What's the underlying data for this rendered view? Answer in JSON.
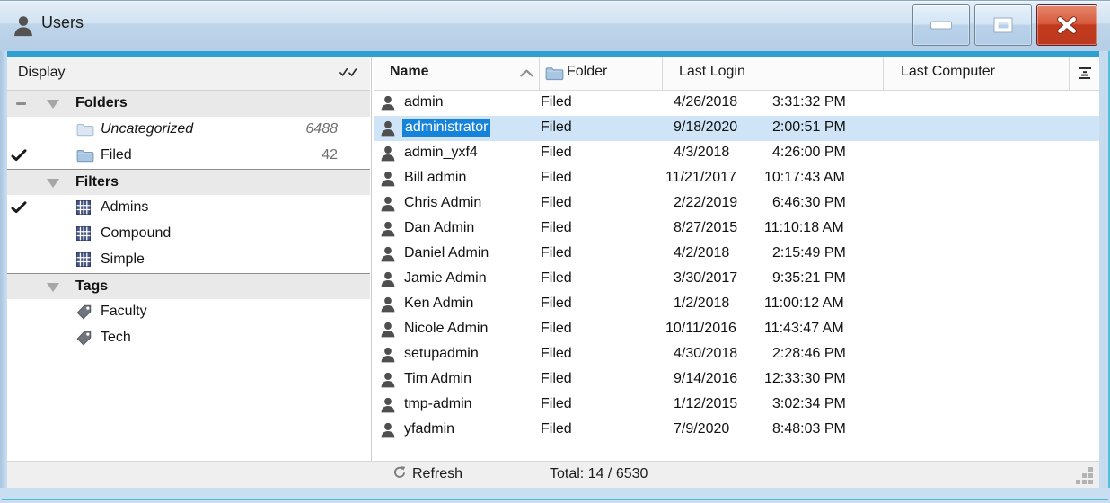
{
  "window": {
    "title": "Users",
    "controls": {
      "minimize": "minimize",
      "maximize": "maximize",
      "close": "close"
    }
  },
  "left_panel": {
    "header_label": "Display",
    "sections": [
      {
        "label": "Folders",
        "has_minus": true,
        "items": [
          {
            "label": "Uncategorized",
            "icon": "folder-empty",
            "count": "6488",
            "italic": true,
            "checked": false
          },
          {
            "label": "Filed",
            "icon": "folder",
            "count": "42",
            "italic": false,
            "checked": true
          }
        ]
      },
      {
        "label": "Filters",
        "has_minus": false,
        "items": [
          {
            "label": "Admins",
            "icon": "filter-grid",
            "checked": true
          },
          {
            "label": "Compound",
            "icon": "filter-grid",
            "checked": false
          },
          {
            "label": "Simple",
            "icon": "filter-grid",
            "checked": false
          }
        ]
      },
      {
        "label": "Tags",
        "has_minus": false,
        "items": [
          {
            "label": "Faculty",
            "icon": "tag",
            "checked": false
          },
          {
            "label": "Tech",
            "icon": "tag",
            "checked": false
          }
        ]
      }
    ]
  },
  "table": {
    "columns": {
      "name": "Name",
      "folder": "Folder",
      "last_login": "Last Login",
      "last_computer": "Last Computer"
    },
    "sort": {
      "column": "Name",
      "direction": "ascending"
    },
    "rows": [
      {
        "name": "admin",
        "folder": "Filed",
        "login_date": "4/26/2018",
        "login_time": "3:31:32 PM",
        "last_computer": "",
        "selected": false
      },
      {
        "name": "administrator",
        "folder": "Filed",
        "login_date": "9/18/2020",
        "login_time": "2:00:51 PM",
        "last_computer": "",
        "selected": true
      },
      {
        "name": "admin_yxf4",
        "folder": "Filed",
        "login_date": "4/3/2018",
        "login_time": "4:26:00 PM",
        "last_computer": "",
        "selected": false
      },
      {
        "name": "Bill admin",
        "folder": "Filed",
        "login_date": "11/21/2017",
        "login_time": "10:17:43 AM",
        "last_computer": "",
        "selected": false
      },
      {
        "name": "Chris Admin",
        "folder": "Filed",
        "login_date": "2/22/2019",
        "login_time": "6:46:30 PM",
        "last_computer": "",
        "selected": false
      },
      {
        "name": "Dan Admin",
        "folder": "Filed",
        "login_date": "8/27/2015",
        "login_time": "11:10:18 AM",
        "last_computer": "",
        "selected": false
      },
      {
        "name": "Daniel Admin",
        "folder": "Filed",
        "login_date": "4/2/2018",
        "login_time": "2:15:49 PM",
        "last_computer": "",
        "selected": false
      },
      {
        "name": "Jamie Admin",
        "folder": "Filed",
        "login_date": "3/30/2017",
        "login_time": "9:35:21 PM",
        "last_computer": "",
        "selected": false
      },
      {
        "name": "Ken Admin",
        "folder": "Filed",
        "login_date": "1/2/2018",
        "login_time": "11:00:12 AM",
        "last_computer": "",
        "selected": false
      },
      {
        "name": "Nicole Admin",
        "folder": "Filed",
        "login_date": "10/11/2016",
        "login_time": "11:43:47 AM",
        "last_computer": "",
        "selected": false
      },
      {
        "name": "setupadmin",
        "folder": "Filed",
        "login_date": "4/30/2018",
        "login_time": "2:28:46 PM",
        "last_computer": "",
        "selected": false
      },
      {
        "name": "Tim Admin",
        "folder": "Filed",
        "login_date": "9/14/2016",
        "login_time": "12:33:30 PM",
        "last_computer": "",
        "selected": false
      },
      {
        "name": "tmp-admin",
        "folder": "Filed",
        "login_date": "1/12/2015",
        "login_time": "3:02:34 PM",
        "last_computer": "",
        "selected": false
      },
      {
        "name": "yfadmin",
        "folder": "Filed",
        "login_date": "7/9/2020",
        "login_time": "8:48:03 PM",
        "last_computer": "",
        "selected": false
      }
    ]
  },
  "statusbar": {
    "refresh_label": "Refresh",
    "total_label": "Total: 14 / 6530"
  },
  "icons": [
    "user-icon",
    "check-icon",
    "folder-icon",
    "filter-grid-icon",
    "tag-icon",
    "collapse-minus-icon",
    "collapse-triangle-icon",
    "double-check-icon",
    "sort-asc-icon",
    "column-chooser-icon",
    "refresh-icon",
    "minimize-icon",
    "maximize-icon",
    "close-icon",
    "resize-grip"
  ],
  "colors": {
    "accent_strip": "#2d9fd1",
    "titlebar_top": "#e3eef8",
    "titlebar_bottom": "#b6cee6",
    "selection_row_bg": "#cfe5f7",
    "selection_name_bg": "#1583d9",
    "close_button": "#c23a1d",
    "window_border": "#c9def1",
    "cyan_edge": "#4dbbd9"
  }
}
